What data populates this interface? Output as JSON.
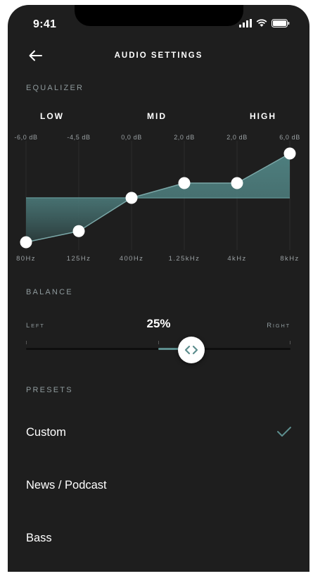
{
  "status_bar": {
    "time": "9:41"
  },
  "header": {
    "title": "AUDIO SETTINGS"
  },
  "equalizer": {
    "label": "EQUALIZER",
    "bands": [
      "LOW",
      "MID",
      "HIGH"
    ],
    "points": [
      {
        "freq": "80Hz",
        "gain_label": "-6,0 dB",
        "gain": -6.0
      },
      {
        "freq": "125Hz",
        "gain_label": "-4,5 dB",
        "gain": -4.5
      },
      {
        "freq": "400Hz",
        "gain_label": "0,0 dB",
        "gain": 0.0
      },
      {
        "freq": "1.25kHz",
        "gain_label": "2,0 dB",
        "gain": 2.0
      },
      {
        "freq": "4kHz",
        "gain_label": "2,0 dB",
        "gain": 2.0
      },
      {
        "freq": "8kHz",
        "gain_label": "6,0 dB",
        "gain": 6.0
      }
    ],
    "gain_range": [
      -6,
      6
    ],
    "fill_color": "#4e7f7f"
  },
  "balance": {
    "label": "BALANCE",
    "left_label": "Left",
    "right_label": "Right",
    "value_label": "25%",
    "value": 0.25,
    "accent_color": "#5d8e8e"
  },
  "presets": {
    "label": "PRESETS",
    "items": [
      {
        "label": "Custom",
        "selected": true
      },
      {
        "label": "News / Podcast",
        "selected": false
      },
      {
        "label": "Bass",
        "selected": false
      }
    ],
    "check_color": "#5d8e8e"
  }
}
